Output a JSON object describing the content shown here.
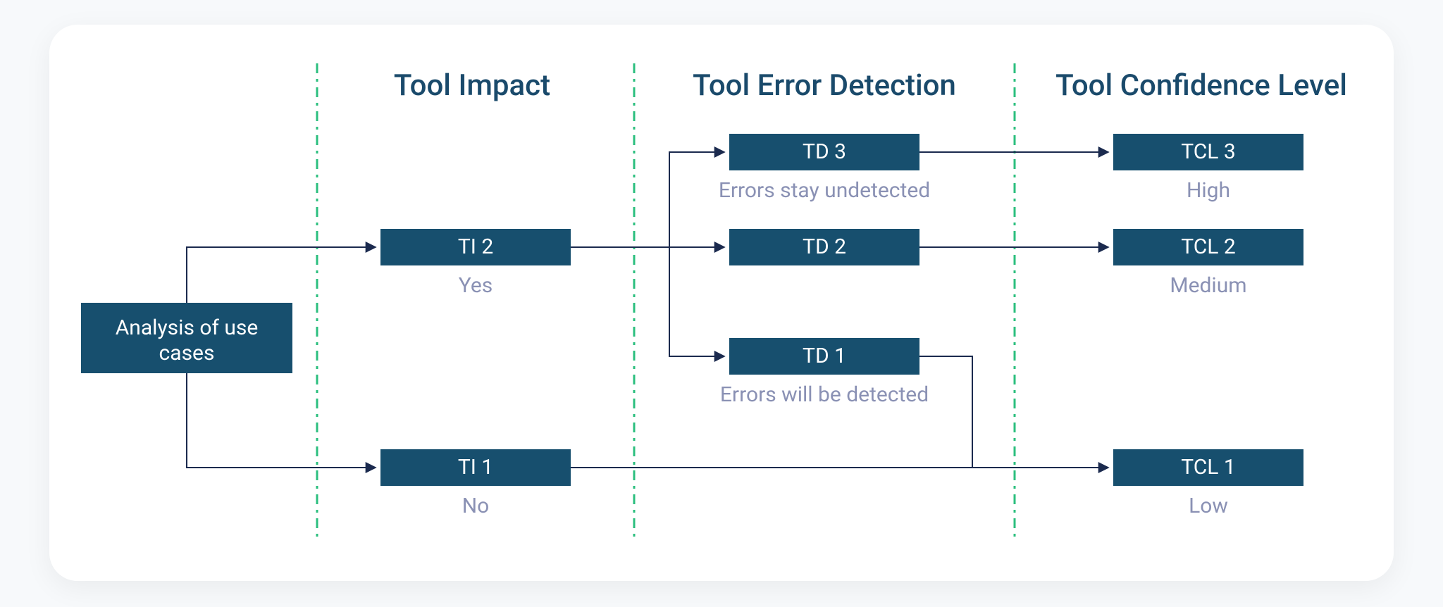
{
  "columns": {
    "impact": "Tool Impact",
    "detection": "Tool Error Detection",
    "confidence": "Tool Confidence Level"
  },
  "nodes": {
    "analysis": "Analysis of use cases",
    "ti2": {
      "label": "TI 2",
      "sub": "Yes"
    },
    "ti1": {
      "label": "TI 1",
      "sub": "No"
    },
    "td3": {
      "label": "TD 3",
      "sub": "Errors stay undetected"
    },
    "td2": {
      "label": "TD 2",
      "sub": ""
    },
    "td1": {
      "label": "TD 1",
      "sub": "Errors will be detected"
    },
    "tcl3": {
      "label": "TCL 3",
      "sub": "High"
    },
    "tcl2": {
      "label": "TCL 2",
      "sub": "Medium"
    },
    "tcl1": {
      "label": "TCL 1",
      "sub": "Low"
    }
  }
}
